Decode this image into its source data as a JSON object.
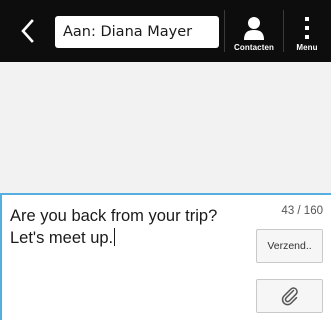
{
  "header": {
    "recipient": "Aan: Diana Mayer",
    "contacts_label": "Contacten",
    "menu_label": "Menu",
    "icons": {
      "back": "chevron-left-icon",
      "contacts": "person-icon",
      "menu": "vertical-dots-icon"
    }
  },
  "composer": {
    "message": "Are you back from your trip? Let's meet up.",
    "counter": "43 / 160",
    "send_label": "Verzend..",
    "attach_icon": "paperclip-icon"
  },
  "colors": {
    "bar": "#0d0d0d",
    "background": "#f2f2f2",
    "accent": "#54aee0"
  }
}
